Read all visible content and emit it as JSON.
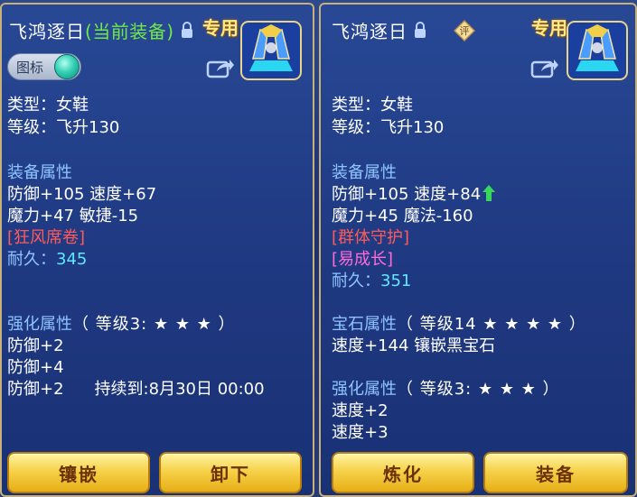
{
  "left_panel": {
    "title": "飞鸿逐日",
    "title_tag": "(当前装备)",
    "special": "专用",
    "badge_label": "图标",
    "type_line": "类型：女鞋",
    "level_line": "等级：飞升130",
    "equip_header": "装备属性",
    "attr1": "防御+105 速度+67",
    "attr2": "魔力+47 敏捷-15",
    "special_skill": "[狂风席卷]",
    "durability_label": "耐久：",
    "durability_value": "345",
    "enhance_header": "强化属性",
    "enhance_level": "（ 等级3: ★ ★ ★ ）",
    "enhance1": "防御+2",
    "enhance2": "防御+4",
    "enhance3": "防御+2",
    "enhance3_duration": "持续到:8月30日 00:00",
    "btn_inlay": "镶嵌",
    "btn_unequip": "卸下"
  },
  "right_panel": {
    "title": "飞鸿逐日",
    "comment_icon_text": "评",
    "special": "专用",
    "type_line": "类型：女鞋",
    "level_line": "等级：飞升130",
    "equip_header": "装备属性",
    "attr1": "防御+105 速度+84",
    "attr2": "魔力+45 魔法-160",
    "special_skill": "[群体守护]",
    "special_effect": "[易成长]",
    "durability_label": "耐久：",
    "durability_value": "351",
    "gem_header": "宝石属性",
    "gem_level": "（ 等级14 ★ ★ ★ ★ ）",
    "gem_line": "速度+144 镶嵌黑宝石",
    "enhance_header": "强化属性",
    "enhance_level": "（ 等级3: ★ ★ ★ ）",
    "enhance1": "速度+2",
    "enhance2": "速度+3",
    "btn_refine": "炼化",
    "btn_equip": "装备"
  },
  "colors": {
    "section": "#8fc4ff",
    "green_tag": "#6fe84a",
    "red_skill": "#ff5a5a",
    "pink_effect": "#ff6ad8",
    "cyan_value": "#5fe8ff",
    "button_gold": "#f6d24a"
  }
}
